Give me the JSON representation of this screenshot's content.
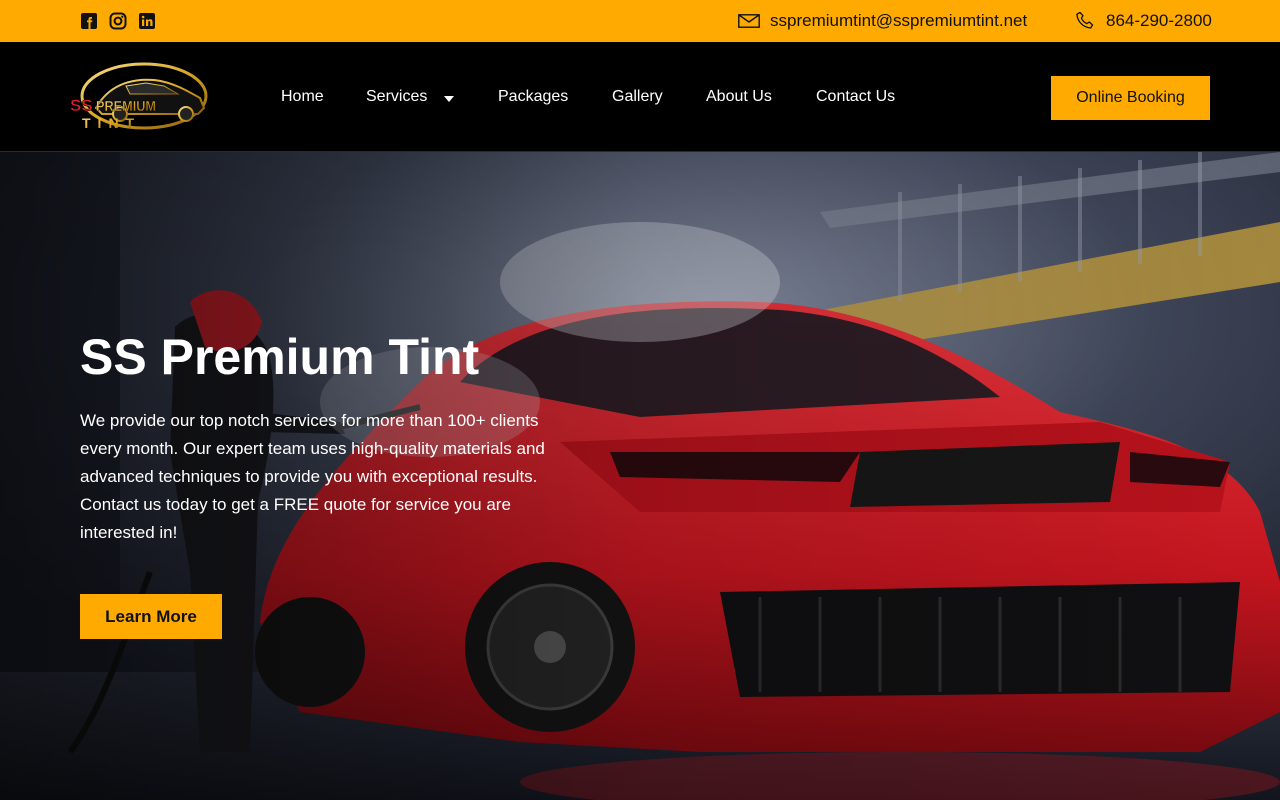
{
  "topbar": {
    "social": [
      "facebook-icon",
      "instagram-icon",
      "linkedin-icon"
    ],
    "email": "sspremiumtint@sspremiumtint.net",
    "phone": "864-290-2800"
  },
  "header": {
    "logo_text_line1": "SS PREMIUM",
    "logo_text_line2": "TINT",
    "nav": {
      "home": "Home",
      "services": "Services",
      "packages": "Packages",
      "gallery": "Gallery",
      "about": "About Us",
      "contact": "Contact Us"
    },
    "booking": "Online Booking"
  },
  "hero": {
    "title": "SS Premium Tint",
    "text": "We provide our top notch services for more than 100+ clients every month. Our expert team uses high-quality materials and advanced techniques to provide you with exceptional results. Contact us today to get a FREE quote for service you are interested in!",
    "cta": "Learn More"
  },
  "colors": {
    "accent": "#FFAA00",
    "header_bg": "#000000",
    "car_red": "#D1222B"
  }
}
